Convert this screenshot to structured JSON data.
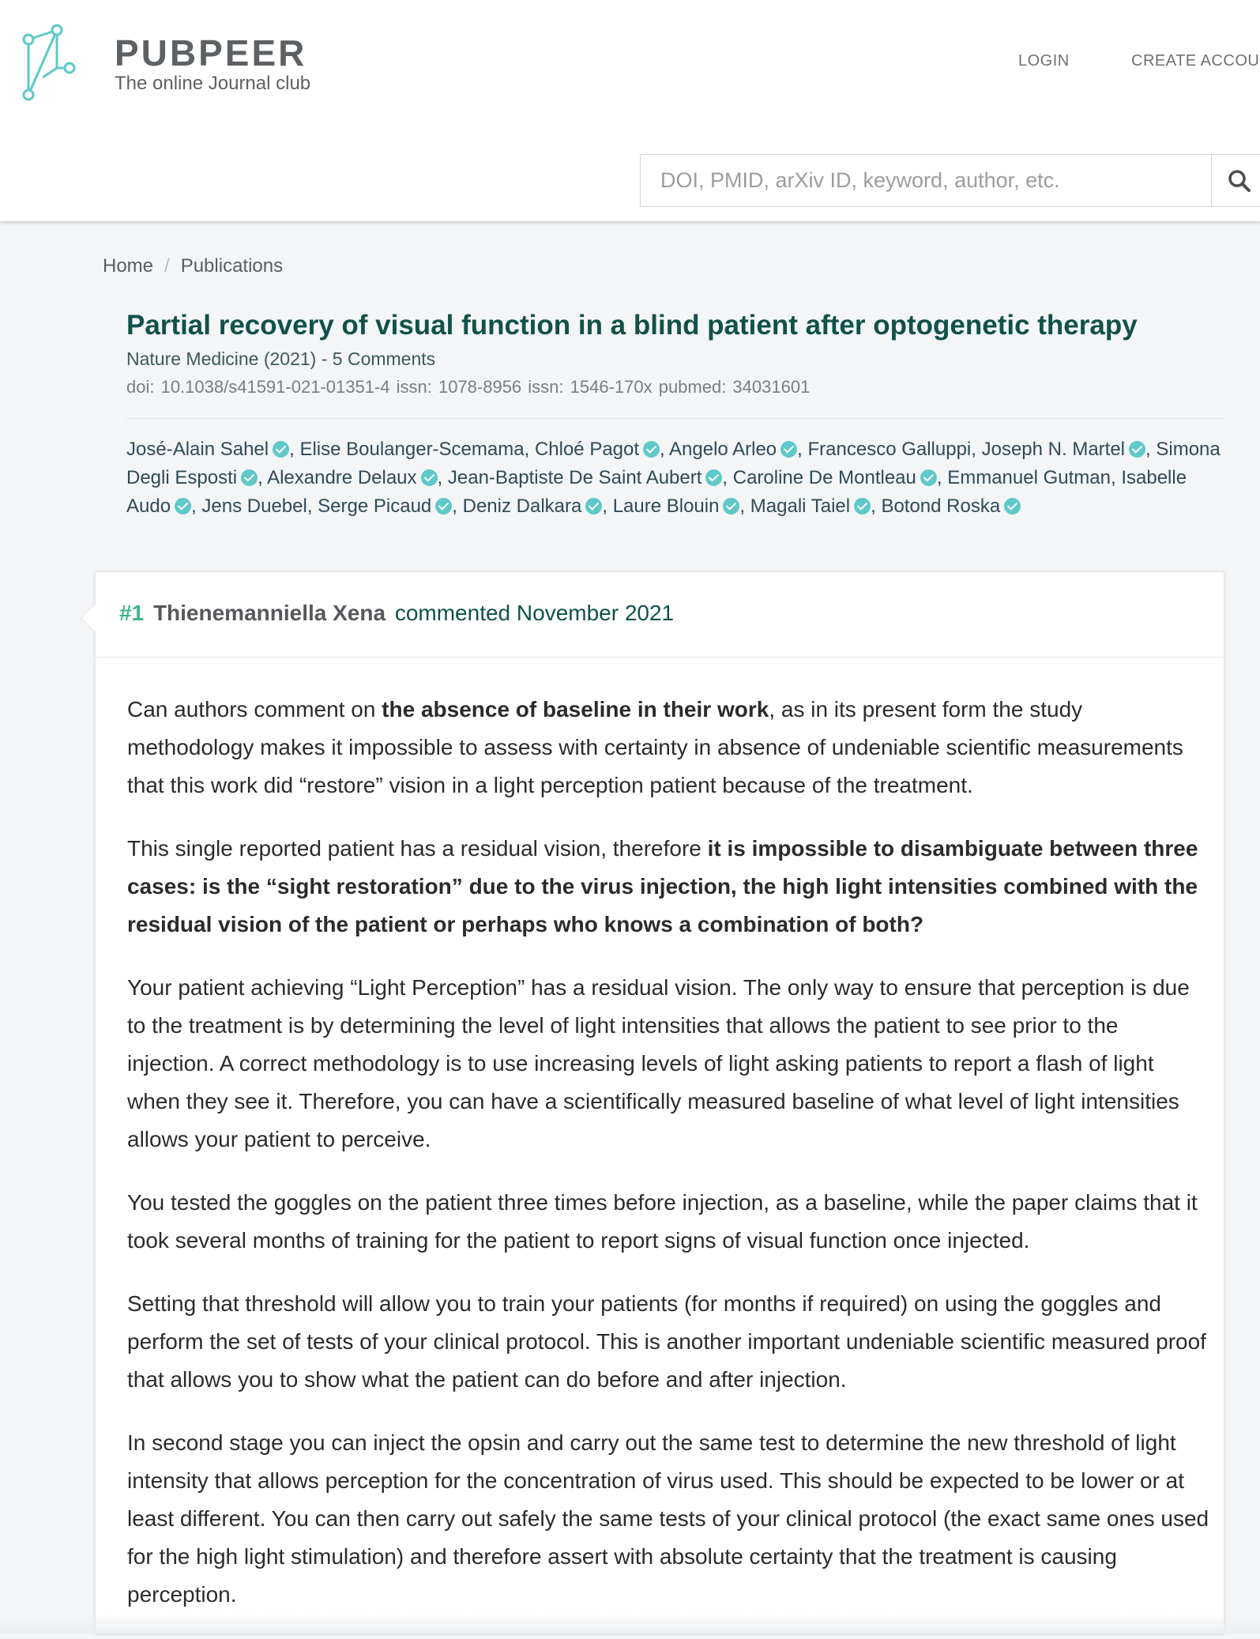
{
  "header": {
    "logo_title": "PUBPEER",
    "logo_tagline": "The online Journal club",
    "nav": {
      "login": "LOGIN",
      "create_account": "CREATE ACCOUNT"
    },
    "search": {
      "placeholder": "DOI, PMID, arXiv ID, keyword, author, etc.",
      "icon": "search-icon"
    },
    "logo_color": "#5fc8c8"
  },
  "breadcrumb": {
    "home": "Home",
    "separator": "/",
    "current": "Publications"
  },
  "publication": {
    "title": "Partial recovery of visual function in a blind patient after optogenetic therapy",
    "journal_line": "Nature Medicine (2021) - 5 Comments",
    "ids_line": "doi: 10.1038/s41591-021-01351-4  issn: 1078-8956  issn: 1546-170x  pubmed: 34031601",
    "authors": [
      {
        "name": "José-Alain Sahel",
        "verified": true
      },
      {
        "name": "Elise Boulanger-Scemama",
        "verified": false
      },
      {
        "name": "Chloé Pagot",
        "verified": true
      },
      {
        "name": "Angelo Arleo",
        "verified": true
      },
      {
        "name": "Francesco Galluppi",
        "verified": false
      },
      {
        "name": "Joseph N. Martel",
        "verified": true
      },
      {
        "name": "Simona Degli Esposti",
        "verified": true
      },
      {
        "name": "Alexandre Delaux",
        "verified": true
      },
      {
        "name": "Jean-Baptiste De Saint Aubert",
        "verified": true
      },
      {
        "name": "Caroline De Montleau",
        "verified": true
      },
      {
        "name": "Emmanuel Gutman",
        "verified": false
      },
      {
        "name": "Isabelle Audo",
        "verified": true
      },
      {
        "name": "Jens Duebel",
        "verified": false
      },
      {
        "name": "Serge Picaud",
        "verified": true
      },
      {
        "name": "Deniz Dalkara",
        "verified": true
      },
      {
        "name": "Laure Blouin",
        "verified": true
      },
      {
        "name": "Magali Taiel",
        "verified": true
      },
      {
        "name": "Botond Roska",
        "verified": true
      }
    ]
  },
  "comment": {
    "number": "#1",
    "author": "Thienemanniella Xena",
    "action": "commented November 2021",
    "paragraphs": [
      [
        {
          "text": "Can authors comment on "
        },
        {
          "text": "the absence of baseline in their work",
          "bold": true
        },
        {
          "text": ", as in its present form the study methodology makes it impossible to assess with certainty in absence of undeniable scientific measurements that this work did “restore” vision in a light perception patient because of the treatment."
        }
      ],
      [
        {
          "text": "This single reported patient has a residual vision, therefore "
        },
        {
          "text": "it is impossible to disambiguate between three cases: is the “sight restoration” due to the virus injection, the high light intensities combined with the residual vision of the patient or perhaps who knows a combination of both?",
          "bold": true
        }
      ],
      [
        {
          "text": "Your patient achieving “Light Perception” has a residual vision. The only way to ensure that perception is due to the treatment is by determining the level of light intensities that allows the patient to see prior to the injection. A correct methodology is to use increasing levels of light asking patients to report a flash of light when they see it. Therefore, you can have a scientifically measured baseline of what level of light intensities allows your patient to perceive."
        }
      ],
      [
        {
          "text": "You tested the goggles on the patient three times before injection, as a baseline, while the paper claims that it took several months of training for the patient to report signs of visual function once injected."
        }
      ],
      [
        {
          "text": "Setting that threshold will allow you to train your patients (for months if required) on using the goggles and perform the set of tests of your clinical protocol. This is another important undeniable scientific measured proof that allows you to show what the patient can do before and after injection."
        }
      ],
      [
        {
          "text": "In second stage you can inject the opsin and carry out the same test to determine the new threshold of light intensity that allows perception for the concentration of virus used. This should be expected to be lower or at least different. You can then carry out safely the same tests of your clinical protocol (the exact same ones used for the high light stimulation) and therefore assert with absolute certainty that the treatment is causing perception."
        }
      ]
    ]
  },
  "colors": {
    "title": "#11514a",
    "comment_number": "#3fb58a",
    "verified_badge": "#5fc8c8",
    "background": "#f3f5f7"
  }
}
